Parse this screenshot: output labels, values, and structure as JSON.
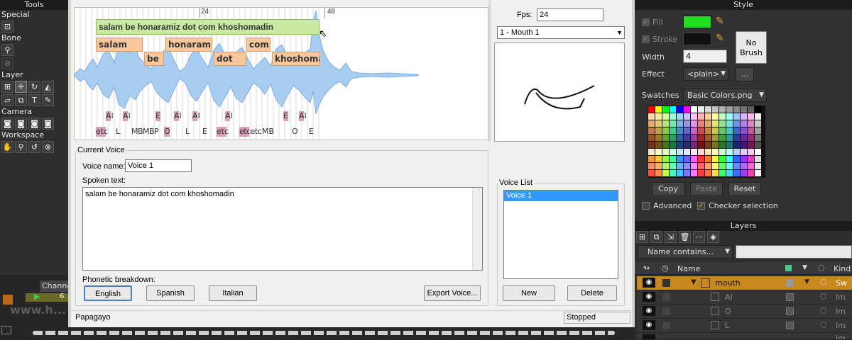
{
  "left_panel": {
    "tools_label": "Tools",
    "special_label": "Special",
    "bone_label": "Bone",
    "layer_label": "Layer",
    "camera_label": "Camera",
    "workspace_label": "Workspace",
    "channels_label": "Channe",
    "frame_value": "6"
  },
  "watermark": "www.h...",
  "dialog": {
    "fps_label": "Fps:",
    "fps_value": "24",
    "mouth_select": "1 - Mouth 1",
    "ruler": {
      "mark1": "24",
      "mark2": "48"
    },
    "phrase": "salam be honaramiz dot com khoshomadin",
    "words": [
      "salam",
      "be",
      "honaramiz",
      "dot",
      "com",
      "khoshoma"
    ],
    "phonemes_top": [
      "AI",
      "AI",
      "E",
      "AI",
      "AI",
      "AI",
      "E",
      "AI"
    ],
    "phonemes_bottom": [
      "etc",
      "L",
      "MBMBP",
      "O",
      "L",
      "E",
      "etc",
      "etcetc",
      "MB",
      "O",
      "E"
    ],
    "current_voice_legend": "Current Voice",
    "voice_name_label": "Voice name:",
    "voice_name_value": "Voice 1",
    "spoken_text_label": "Spoken text:",
    "spoken_text_value": "salam be honaramiz dot com khoshomadin",
    "phonetic_label": "Phonetic breakdown:",
    "english_btn": "English",
    "spanish_btn": "Spanish",
    "italian_btn": "Italian",
    "export_btn": "Export Voice...",
    "voice_list_legend": "Voice List",
    "voice_list_items": [
      "Voice 1"
    ],
    "new_btn": "New",
    "delete_btn": "Delete",
    "status_left": "Papagayo",
    "status_right": "Stopped"
  },
  "style_panel": {
    "title": "Style",
    "fill_label": "Fill",
    "fill_color": "#1fe01f",
    "stroke_label": "Stroke",
    "stroke_color": "#111111",
    "no_brush": "No Brush",
    "width_label": "Width",
    "width_value": "4",
    "effect_label": "Effect",
    "effect_value": "<plain>",
    "effect_more": "...",
    "swatches_label": "Swatches",
    "swatches_value": "Basic Colors.png",
    "copy_btn": "Copy",
    "paste_btn": "Paste",
    "reset_btn": "Reset",
    "advanced_label": "Advanced",
    "checker_label": "Checker selection"
  },
  "layers_panel": {
    "title": "Layers",
    "filter_value": "Name contains...",
    "col_name": "Name",
    "col_kind": "Kind",
    "rows": [
      {
        "name": "mouth",
        "kind": "Sw"
      },
      {
        "name": "AI",
        "kind": "Im"
      },
      {
        "name": "O",
        "kind": "Im"
      },
      {
        "name": "L",
        "kind": "Im"
      },
      {
        "name": "",
        "kind": "Im"
      }
    ]
  }
}
